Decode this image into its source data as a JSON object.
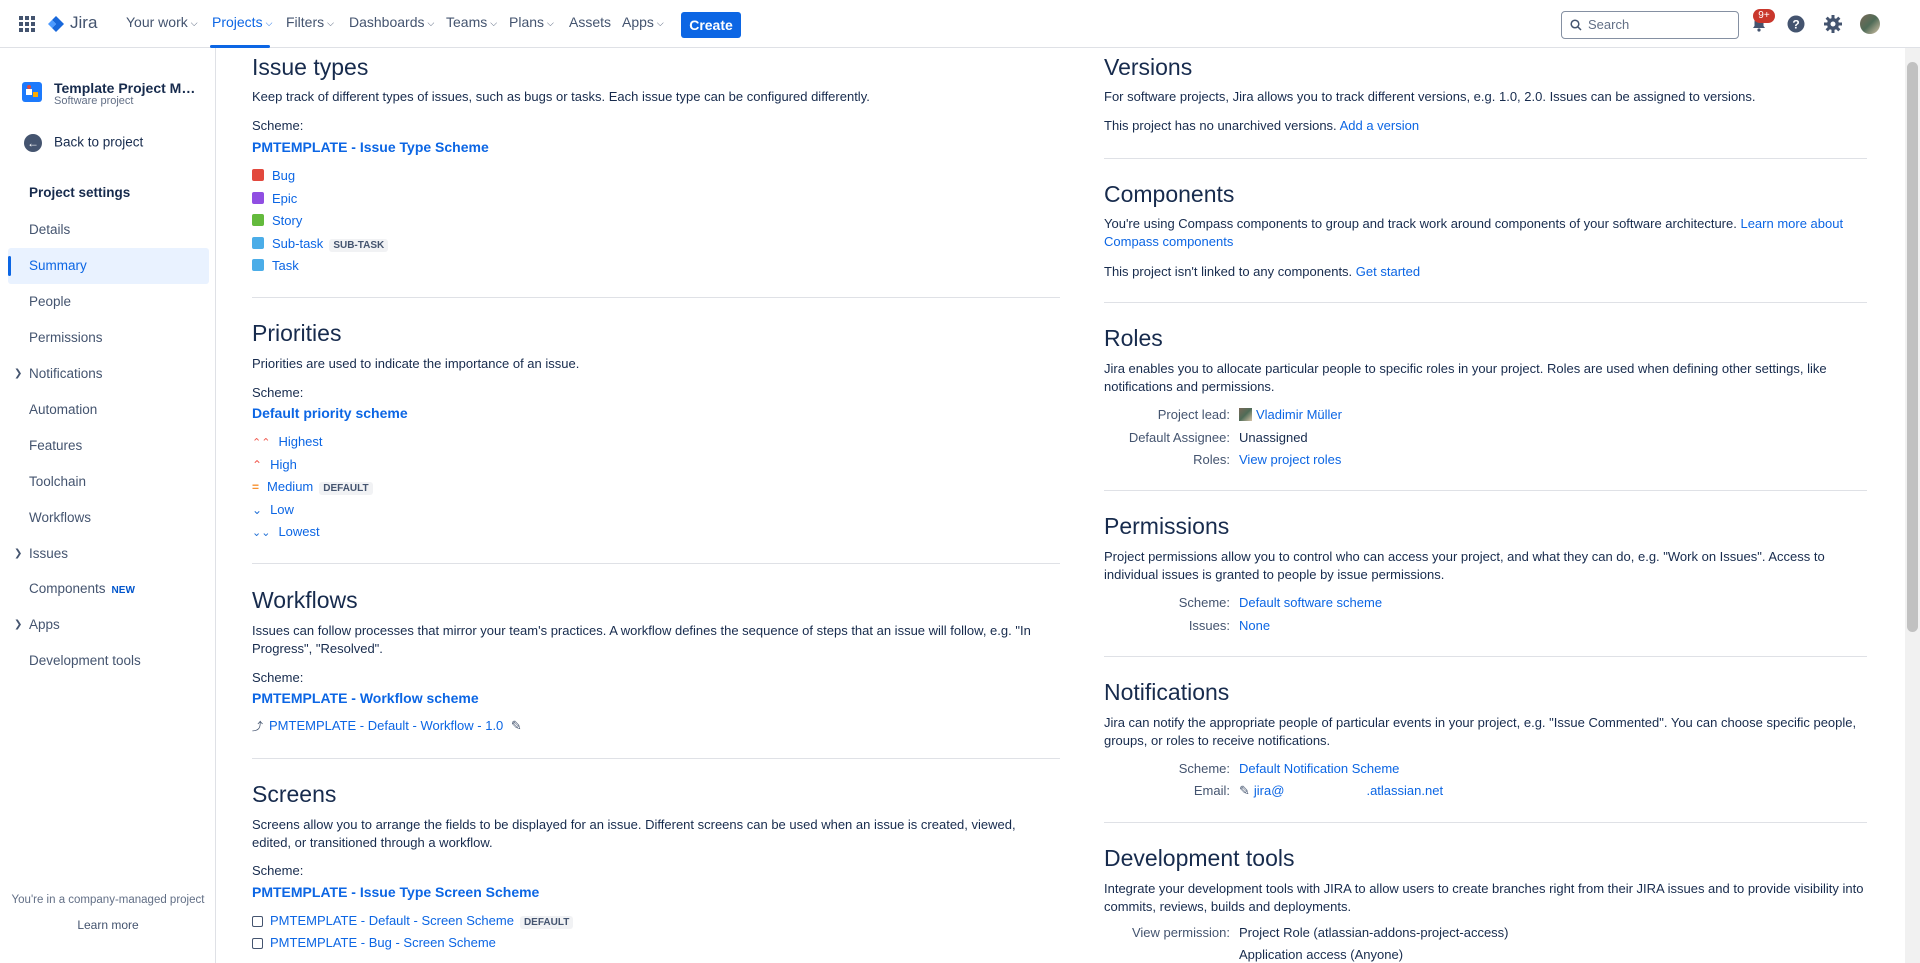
{
  "nav": {
    "logo": "Jira",
    "items": [
      "Your work",
      "Projects",
      "Filters",
      "Dashboards",
      "Teams",
      "Plans",
      "Assets",
      "Apps"
    ],
    "create": "Create",
    "search_placeholder": "Search",
    "notif_badge": "9+"
  },
  "sidebar": {
    "project_name": "Template Project Manag...",
    "project_type": "Software project",
    "back": "Back to project",
    "settings_heading": "Project settings",
    "items": [
      "Details",
      "Summary",
      "People",
      "Permissions",
      "Notifications",
      "Automation",
      "Features",
      "Toolchain",
      "Workflows",
      "Issues",
      "Components",
      "Apps",
      "Development tools"
    ],
    "components_badge": "NEW",
    "company_note": "You're in a company-managed project",
    "learn_more": "Learn more"
  },
  "issue_types": {
    "title": "Issue types",
    "desc": "Keep track of different types of issues, such as bugs or tasks. Each issue type can be configured differently.",
    "scheme_label": "Scheme:",
    "scheme": "PMTEMPLATE - Issue Type Scheme",
    "items": [
      {
        "name": "Bug",
        "color": "#e2483d"
      },
      {
        "name": "Epic",
        "color": "#904ee2"
      },
      {
        "name": "Story",
        "color": "#63ba3c"
      },
      {
        "name": "Sub-task",
        "color": "#4bade8",
        "badge": "SUB-TASK"
      },
      {
        "name": "Task",
        "color": "#4bade8"
      }
    ]
  },
  "priorities": {
    "title": "Priorities",
    "desc": "Priorities are used to indicate the importance of an issue.",
    "scheme_label": "Scheme:",
    "scheme": "Default priority scheme",
    "items": [
      {
        "name": "Highest",
        "color": "#f15b50"
      },
      {
        "name": "High",
        "color": "#f15b50"
      },
      {
        "name": "Medium",
        "color": "#f79232",
        "badge": "DEFAULT"
      },
      {
        "name": "Low",
        "color": "#2d8738"
      },
      {
        "name": "Lowest",
        "color": "#2d8738"
      }
    ]
  },
  "workflows": {
    "title": "Workflows",
    "desc": "Issues can follow processes that mirror your team's practices. A workflow defines the sequence of steps that an issue will follow, e.g. \"In Progress\", \"Resolved\".",
    "scheme_label": "Scheme:",
    "scheme": "PMTEMPLATE - Workflow scheme",
    "item": "PMTEMPLATE - Default - Workflow - 1.0"
  },
  "screens": {
    "title": "Screens",
    "desc": "Screens allow you to arrange the fields to be displayed for an issue. Different screens can be used when an issue is created, viewed, edited, or transitioned through a workflow.",
    "scheme_label": "Scheme:",
    "scheme": "PMTEMPLATE - Issue Type Screen Scheme",
    "items": [
      {
        "name": "PMTEMPLATE - Default - Screen Scheme",
        "badge": "DEFAULT"
      },
      {
        "name": "PMTEMPLATE - Bug - Screen Scheme"
      }
    ]
  },
  "versions": {
    "title": "Versions",
    "desc": "For software projects, Jira allows you to track different versions, e.g. 1.0, 2.0. Issues can be assigned to versions.",
    "status": "This project has no unarchived versions.",
    "link": "Add a version"
  },
  "components": {
    "title": "Components",
    "desc": "You're using Compass components to group and track work around components of your software architecture.",
    "desc_link_1": "Learn more about",
    "desc_link_2": "Compass components",
    "status": "This project isn't linked to any components.",
    "link": "Get started"
  },
  "roles": {
    "title": "Roles",
    "desc": "Jira enables you to allocate particular people to specific roles in your project. Roles are used when defining other settings, like notifications and permissions.",
    "lead_key": "Project lead:",
    "lead_val": "Vladimir Müller",
    "assignee_key": "Default Assignee:",
    "assignee_val": "Unassigned",
    "roles_key": "Roles:",
    "roles_val": "View project roles"
  },
  "permissions": {
    "title": "Permissions",
    "desc": "Project permissions allow you to control who can access your project, and what they can do, e.g. \"Work on Issues\". Access to individual issues is granted to people by issue permissions.",
    "scheme_key": "Scheme:",
    "scheme_val": "Default software scheme",
    "issues_key": "Issues:",
    "issues_val": "None"
  },
  "notifications": {
    "title": "Notifications",
    "desc": "Jira can notify the appropriate people of particular events in your project, e.g. \"Issue Commented\". You can choose specific people, groups, or roles to receive notifications.",
    "scheme_key": "Scheme:",
    "scheme_val": "Default Notification Scheme",
    "email_key": "Email:",
    "email_val_1": "jira@",
    "email_val_2": ".atlassian.net"
  },
  "dev_tools": {
    "title": "Development tools",
    "desc": "Integrate your development tools with JIRA to allow users to create branches right from their JIRA issues and to provide visibility into commits, reviews, builds and deployments.",
    "perm_key": "View permission:",
    "perm_val_1": "Project Role (atlassian-addons-project-access)",
    "perm_val_2": "Application access (Anyone)"
  }
}
